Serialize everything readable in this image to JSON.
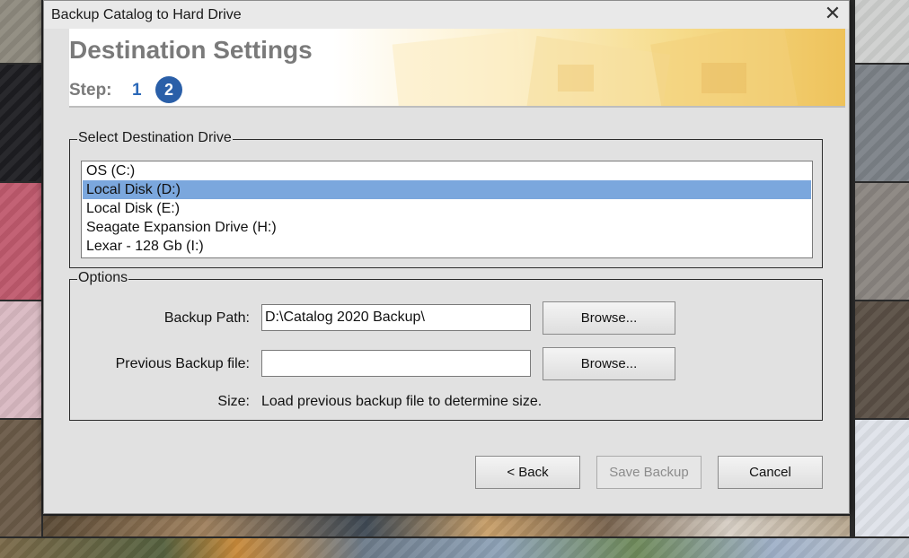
{
  "window": {
    "title": "Backup Catalog to Hard Drive",
    "close_icon": "close-icon"
  },
  "header": {
    "title": "Destination Settings",
    "step_label": "Step:",
    "steps": [
      "1",
      "2"
    ],
    "current_step": "2"
  },
  "destination": {
    "group_label": "Select Destination Drive",
    "drives": [
      "OS (C:)",
      "Local Disk (D:)",
      "Local Disk (E:)",
      "Seagate Expansion Drive (H:)",
      "Lexar - 128 Gb (I:)"
    ],
    "selected_drive": "Local Disk (D:)"
  },
  "options": {
    "group_label": "Options",
    "backup_path_label": "Backup Path:",
    "backup_path_value": "D:\\Catalog 2020 Backup\\",
    "previous_backup_label": "Previous Backup file:",
    "previous_backup_value": "",
    "browse_label": "Browse...",
    "size_label": "Size:",
    "size_value": "Load previous backup file to determine size."
  },
  "buttons": {
    "back": "< Back",
    "save_backup": "Save Backup",
    "cancel": "Cancel"
  },
  "colors": {
    "selection": "#7ba7dd",
    "step_active": "#2a5fa8",
    "header_title": "#7a7a7a"
  }
}
